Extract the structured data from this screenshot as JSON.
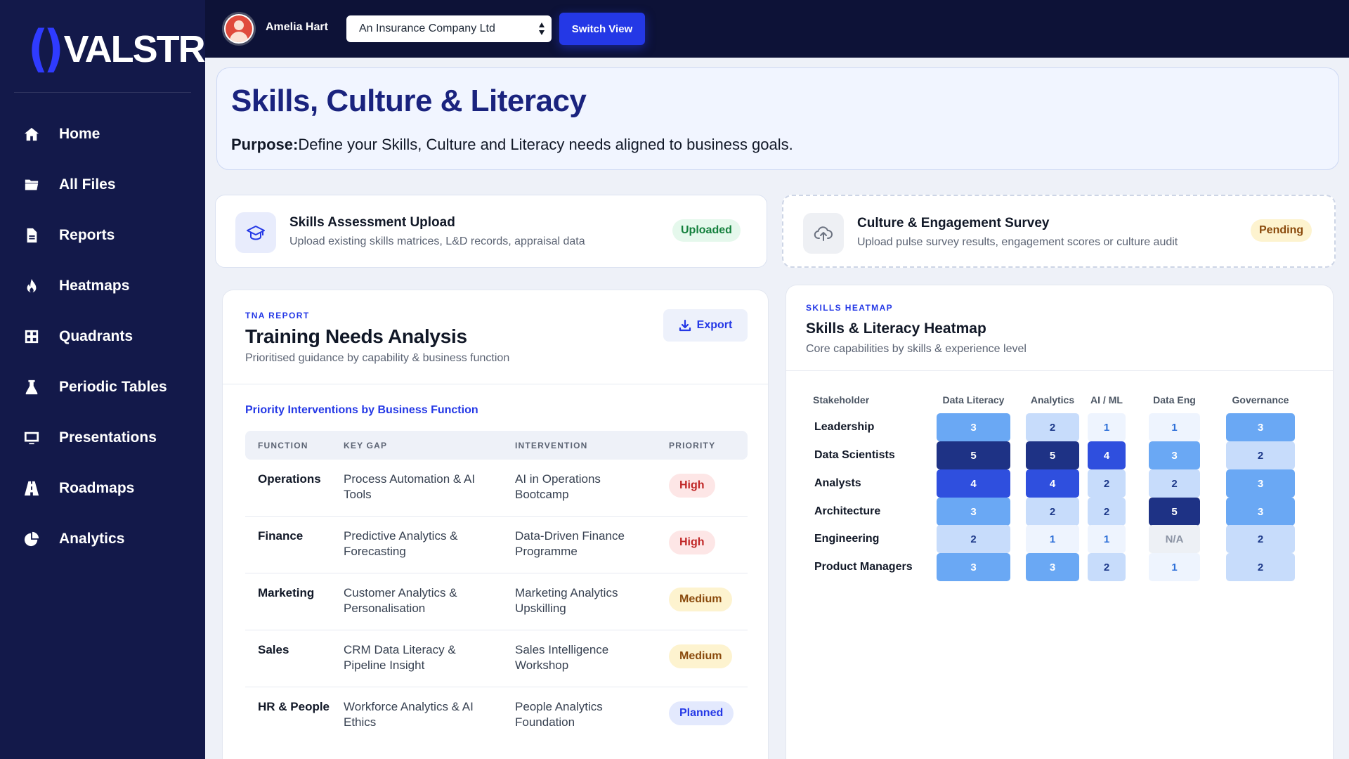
{
  "brand": {
    "name": "VALSTR"
  },
  "sidebar": {
    "items": [
      {
        "label": "Home",
        "icon": "home-icon"
      },
      {
        "label": "All Files",
        "icon": "folder-icon"
      },
      {
        "label": "Reports",
        "icon": "document-icon"
      },
      {
        "label": "Heatmaps",
        "icon": "flame-icon"
      },
      {
        "label": "Quadrants",
        "icon": "grid-icon"
      },
      {
        "label": "Periodic Tables",
        "icon": "flask-icon"
      },
      {
        "label": "Presentations",
        "icon": "monitor-icon"
      },
      {
        "label": "Roadmaps",
        "icon": "road-icon"
      },
      {
        "label": "Analytics",
        "icon": "pie-chart-icon"
      }
    ]
  },
  "topbar": {
    "user_name": "Amelia Hart",
    "company": "An Insurance Company Ltd",
    "switch_label": "Switch View"
  },
  "page": {
    "title": "Skills, Culture & Literacy",
    "purpose_label": "Purpose:",
    "purpose_text": "Define your Skills, Culture and Literacy needs aligned to business goals."
  },
  "uploads": {
    "skills": {
      "title": "Skills Assessment Upload",
      "desc": "Upload existing skills matrices, L&D records, appraisal data",
      "status": "Uploaded"
    },
    "culture": {
      "title": "Culture & Engagement Survey",
      "desc": "Upload pulse survey results, engagement scores or culture audit",
      "status": "Pending"
    }
  },
  "tna": {
    "eyebrow": "TNA REPORT",
    "title": "Training Needs Analysis",
    "subtitle": "Prioritised guidance by capability & business function",
    "export_label": "Export",
    "section_title": "Priority Interventions by Business Function",
    "columns": [
      "FUNCTION",
      "KEY GAP",
      "INTERVENTION",
      "PRIORITY"
    ],
    "rows": [
      {
        "function": "Operations",
        "gap": "Process Automation & AI Tools",
        "intervention": "AI in Operations Bootcamp",
        "priority": "High",
        "level": "high"
      },
      {
        "function": "Finance",
        "gap": "Predictive Analytics & Forecasting",
        "intervention": "Data-Driven Finance Programme",
        "priority": "High",
        "level": "high"
      },
      {
        "function": "Marketing",
        "gap": "Customer Analytics & Personalisation",
        "intervention": "Marketing Analytics Upskilling",
        "priority": "Medium",
        "level": "medium"
      },
      {
        "function": "Sales",
        "gap": "CRM Data Literacy & Pipeline Insight",
        "intervention": "Sales Intelligence Workshop",
        "priority": "Medium",
        "level": "medium"
      },
      {
        "function": "HR & People",
        "gap": "Workforce Analytics & AI Ethics",
        "intervention": "People Analytics Foundation",
        "priority": "Planned",
        "level": "planned"
      }
    ]
  },
  "heatmap": {
    "eyebrow": "SKILLS HEATMAP",
    "title": "Skills & Literacy Heatmap",
    "subtitle": "Core capabilities by skills & experience level",
    "row_header": "Stakeholder",
    "columns": [
      "Data Literacy",
      "Analytics",
      "AI / ML",
      "Data Eng",
      "Governance"
    ],
    "rows": [
      {
        "label": "Leadership",
        "values": [
          "3",
          "2",
          "1",
          "1",
          "3"
        ]
      },
      {
        "label": "Data Scientists",
        "values": [
          "5",
          "5",
          "4",
          "3",
          "2"
        ]
      },
      {
        "label": "Analysts",
        "values": [
          "4",
          "4",
          "2",
          "2",
          "3"
        ]
      },
      {
        "label": "Architecture",
        "values": [
          "3",
          "2",
          "2",
          "5",
          "3"
        ]
      },
      {
        "label": "Engineering",
        "values": [
          "2",
          "1",
          "1",
          "N/A",
          "2"
        ]
      },
      {
        "label": "Product Managers",
        "values": [
          "3",
          "3",
          "2",
          "1",
          "2"
        ]
      }
    ],
    "level_colors": {
      "1": {
        "bg": "#eef4fe",
        "fg": "#2d6fd8"
      },
      "2": {
        "bg": "#c7dcfb",
        "fg": "#1e3a8a"
      },
      "3": {
        "bg": "#6aa8f4",
        "fg": "#ffffff"
      },
      "4": {
        "bg": "#2f4fde",
        "fg": "#ffffff"
      },
      "5": {
        "bg": "#1e3285",
        "fg": "#ffffff"
      },
      "N/A": {
        "bg": "#edf0f5",
        "fg": "#8b93a3"
      }
    }
  }
}
